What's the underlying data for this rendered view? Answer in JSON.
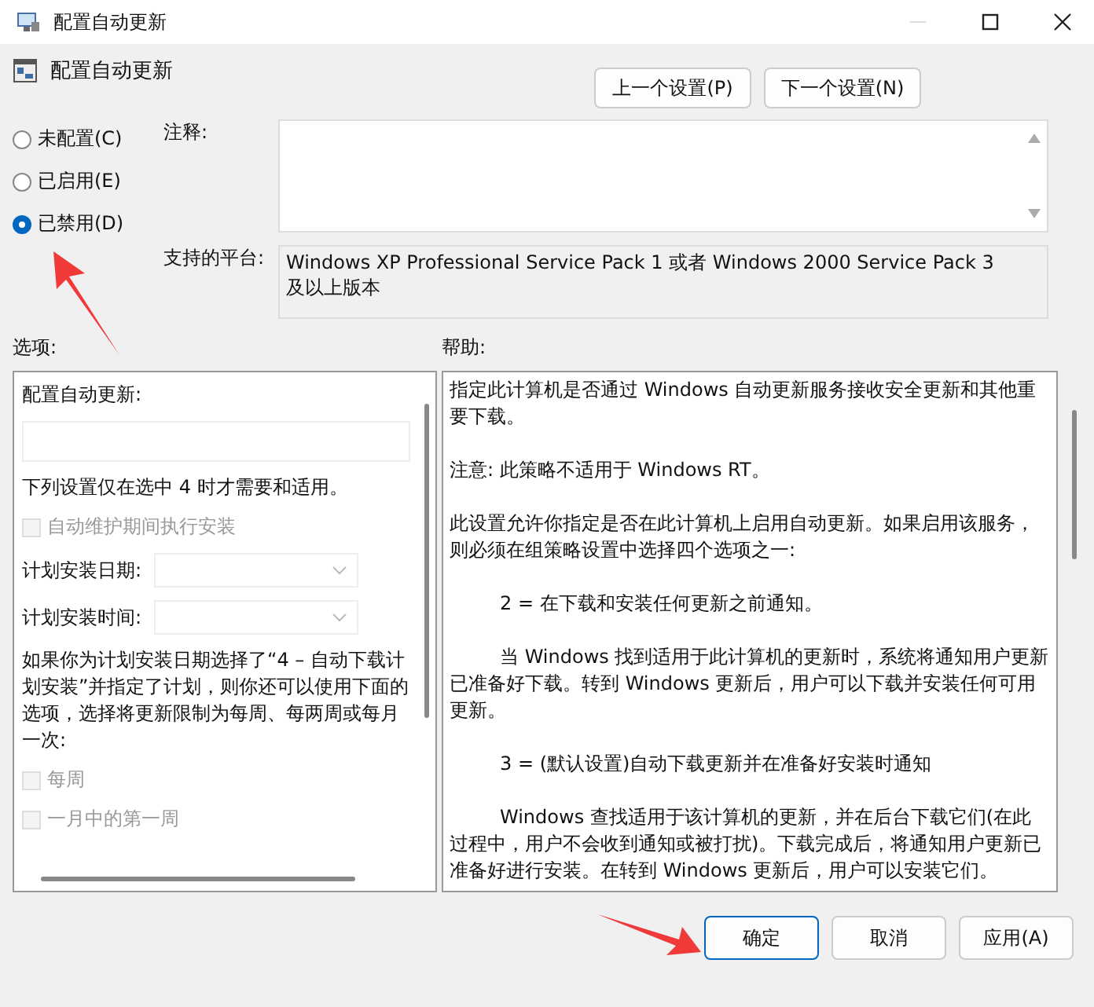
{
  "window": {
    "title": "配置自动更新"
  },
  "header": {
    "title": "配置自动更新",
    "buttons": [
      "上一个设置(P)",
      "下一个设置(N)"
    ]
  },
  "states": [
    {
      "label": "未配置(C)",
      "selected": false
    },
    {
      "label": "已启用(E)",
      "selected": false
    },
    {
      "label": "已禁用(D)",
      "selected": true
    }
  ],
  "comment": {
    "label": "注释:"
  },
  "platform": {
    "label": "支持的平台:",
    "text": "Windows XP Professional Service Pack 1 或者 Windows 2000 Service Pack 3 及以上版本"
  },
  "options": {
    "label": "选项:",
    "items": [
      {
        "kind": "text",
        "text": "配置自动更新:"
      },
      {
        "kind": "field"
      },
      {
        "kind": "text",
        "text": "下列设置仅在选中 4 时才需要和适用。"
      },
      {
        "kind": "checkbox",
        "text": "自动维护期间执行安装",
        "checked": false,
        "disabled": true
      },
      {
        "kind": "dropdown",
        "text": "计划安装日期:"
      },
      {
        "kind": "dropdown",
        "text": "计划安装时间:"
      },
      {
        "kind": "text",
        "text": "如果你为计划安装日期选择了“4 – 自动下载计划安装”并指定了计划，则你还可以使用下面的选项，选择将更新限制为每周、每两周或每月一次:"
      },
      {
        "kind": "checkbox",
        "text": "每周",
        "checked": false,
        "disabled": true
      },
      {
        "kind": "checkbox",
        "text": "一月中的第一周",
        "checked": false,
        "disabled": true
      }
    ]
  },
  "help": {
    "label": "帮助:",
    "paragraphs": [
      {
        "kind": "plain",
        "text": "指定此计算机是否通过 Windows 自动更新服务接收安全更新和其他重要下载。"
      },
      {
        "kind": "plain",
        "text": "注意: 此策略不适用于 Windows RT。"
      },
      {
        "kind": "plain",
        "text": "此设置允许你指定是否在此计算机上启用自动更新。如果启用该服务，则必须在组策略设置中选择四个选项之一:"
      },
      {
        "kind": "indented",
        "text": "2 = 在下载和安装任何更新之前通知。"
      },
      {
        "kind": "indented",
        "text": "当 Windows 找到适用于此计算机的更新时，系统将通知用户更新已准备好下载。转到 Windows 更新后，用户可以下载并安装任何可用更新。"
      },
      {
        "kind": "indented",
        "text": "3 = (默认设置)自动下载更新并在准备好安装时通知"
      },
      {
        "kind": "indented",
        "text": "Windows 查找适用于该计算机的更新，并在后台下载它们(在此过程中，用户不会收到通知或被打扰)。下载完成后，将通知用户更新已准备好进行安装。在转到 Windows 更新后，用户可以安装它们。"
      }
    ]
  },
  "footer": {
    "buttons": [
      {
        "label": "确定",
        "selected": true
      },
      {
        "label": "取消",
        "selected": false
      },
      {
        "label": "应用(A)",
        "selected": false
      }
    ]
  }
}
